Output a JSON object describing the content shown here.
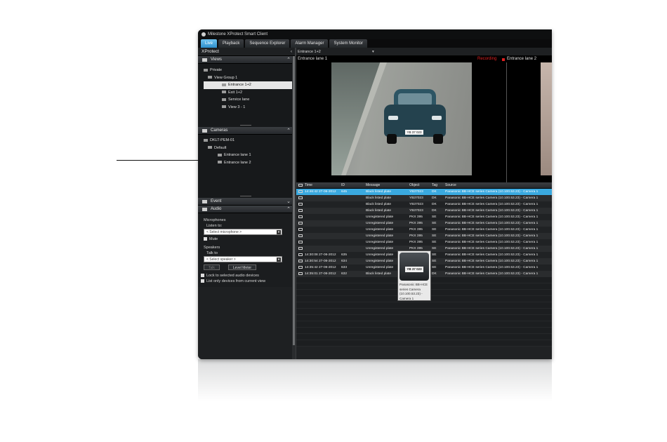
{
  "app": {
    "title": "Milestone XProtect Smart Client",
    "tabs": [
      "Live",
      "Playback",
      "Sequence Explorer",
      "Alarm Manager",
      "System Monitor"
    ],
    "active_tab": "Live",
    "pane_title": "XProtect"
  },
  "views_panel": {
    "header": "Views",
    "items": [
      "Private",
      "View Group 1",
      "Entrance 1+2",
      "Exit 1+2",
      "Service lane",
      "View 3 - 1"
    ],
    "selected": "Entrance 1+2"
  },
  "cameras_panel": {
    "header": "Cameras",
    "items": [
      "DKLT-PEM-01",
      "Default",
      "Entrance lane 1",
      "Entrance lane 2"
    ]
  },
  "event_panel": {
    "header": "Event"
  },
  "audio_panel": {
    "header": "Audio",
    "microphones_label": "Microphones",
    "listen_label": "Listen to:",
    "mic_select": "< Select microphone >",
    "mute_label": "Mute",
    "speakers_label": "Speakers",
    "talk_label": "Talk to",
    "speaker_select": "< Select speaker >",
    "talk_button": "Talk",
    "level_button": "Level Meter",
    "lock_label": "Lock to selected audio devices",
    "list_label": "List only devices from current view"
  },
  "view_selector": {
    "value": "Entrance 1+2"
  },
  "camera_tiles": {
    "left_title": "Entrance lane 1",
    "recording_label": "Recording",
    "right_title": "Entrance lane 2",
    "plate": "YB 37 023"
  },
  "table": {
    "columns": [
      "Time",
      "ID",
      "Message",
      "Object",
      "Tag",
      "Source"
    ],
    "rows": [
      [
        "14:46:42 27-06-2012",
        "645",
        "Black listed plate",
        "YB37023",
        "DK",
        "Panasonic BB-HCE series Camera (10.100.53.23) - Camera 1"
      ],
      [
        "",
        "",
        "Black listed plate",
        "YB37023",
        "DK",
        "Panasonic BB-HCE series Camera (10.100.53.23) - Camera 1"
      ],
      [
        "",
        "",
        "Black listed plate",
        "YB37023",
        "DK",
        "Panasonic BB-HCE series Camera (10.100.53.23) - Camera 1"
      ],
      [
        "",
        "",
        "Black listed plate",
        "YB37023",
        "DK",
        "Panasonic BB-HCE series Camera (10.100.53.23) - Camera 1"
      ],
      [
        "",
        "",
        "Unregistered plate",
        "PKX 395",
        "SE",
        "Panasonic BB-HCE series Camera (10.100.53.23) - Camera 1"
      ],
      [
        "",
        "",
        "Unregistered plate",
        "PKX 395",
        "SE",
        "Panasonic BB-HCE series Camera (10.100.53.23) - Camera 1"
      ],
      [
        "",
        "",
        "Unregistered plate",
        "PKX 395",
        "SE",
        "Panasonic BB-HCE series Camera (10.100.53.23) - Camera 1"
      ],
      [
        "",
        "",
        "Unregistered plate",
        "PKX 395",
        "SE",
        "Panasonic BB-HCE series Camera (10.100.53.23) - Camera 1"
      ],
      [
        "",
        "",
        "Unregistered plate",
        "PKX 395",
        "SE",
        "Panasonic BB-HCE series Camera (10.100.53.23) - Camera 1"
      ],
      [
        "",
        "",
        "Unregistered plate",
        "PKX 395",
        "SE",
        "Panasonic BB-HCE series Camera (10.100.53.23) - Camera 1"
      ],
      [
        "14:30:08 27-06-2012",
        "635",
        "Unregistered plate",
        "PKX 395",
        "SE",
        "Panasonic BB-HCE series Camera (10.100.53.23) - Camera 1"
      ],
      [
        "14:30:54 27-06-2012",
        "634",
        "Unregistered plate",
        "PKX 395",
        "SE",
        "Panasonic BB-HCE series Camera (10.100.53.23) - Camera 1"
      ],
      [
        "14:35:42 27-06-2012",
        "633",
        "Unregistered plate",
        "PKX 395",
        "SE",
        "Panasonic BB-HCE series Camera (10.100.53.23) - Camera 1"
      ],
      [
        "14:35:01 27-06-2012",
        "632",
        "Black listed plate",
        "YB37023",
        "DK",
        "Panasonic BB-HCE series Camera (10.100.53.23) - Camera 1"
      ]
    ]
  },
  "preview": {
    "plate": "YB 37 023",
    "caption": "Panasonic BB-HCE series Camera (10.100.53.23) - Camera 1"
  }
}
